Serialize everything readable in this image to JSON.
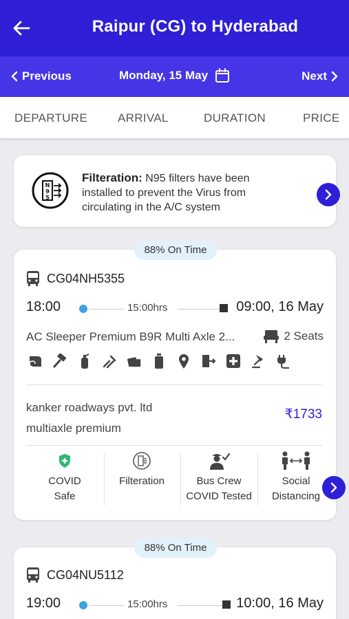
{
  "header": {
    "title": "Raipur (CG) to Hyderabad"
  },
  "datebar": {
    "prev_label": "Previous",
    "date": "Monday, 15 May",
    "next_label": "Next"
  },
  "sort": {
    "departure": "DEPARTURE",
    "arrival": "ARRIVAL",
    "duration": "DURATION",
    "price": "PRICE"
  },
  "notice": {
    "heading": "Filteration:",
    "text": "N95 filters have been installed to prevent the Virus from circulating in the A/C system"
  },
  "buses": [
    {
      "on_time": "88% On Time",
      "bus_number": "CG04NH5355",
      "departure": "18:00",
      "duration": "15:00hrs",
      "arrival": "09:00, 16 May",
      "bus_type": "AC Sleeper Premium B9R Multi Axle 2...",
      "seats": "2 Seats",
      "operator": "kanker roadways pvt. ltd",
      "operator_sub": "multiaxle premium",
      "price": "₹1733",
      "features": [
        {
          "line1": "COVID",
          "line2": "Safe"
        },
        {
          "line1": "Filteration",
          "line2": ""
        },
        {
          "line1": "Bus Crew",
          "line2": "COVID Tested"
        },
        {
          "line1": "Social",
          "line2": "Distancing"
        }
      ]
    },
    {
      "on_time": "88% On Time",
      "bus_number": "CG04NU5112",
      "departure": "19:00",
      "duration": "15:00hrs",
      "arrival": "10:00, 16 May"
    }
  ],
  "amenity_icons": [
    "blanket-icon",
    "hammer-icon",
    "fire-extinguisher-icon",
    "charging-cable-icon",
    "movie-icon",
    "water-bottle-icon",
    "location-pin-icon",
    "emergency-exit-icon",
    "first-aid-icon",
    "reading-light-icon",
    "charging-point-icon"
  ],
  "colors": {
    "primary": "#2f1fd6",
    "datebar": "#4635e6",
    "price": "#2f1fd6",
    "dot": "#3ba3e0",
    "covid_green": "#2eb872"
  }
}
